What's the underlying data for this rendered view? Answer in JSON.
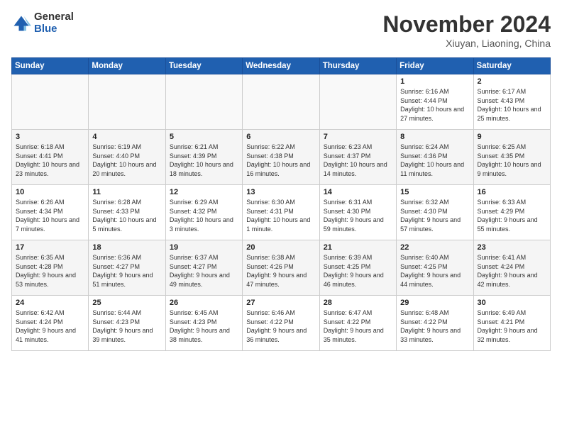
{
  "header": {
    "logo_general": "General",
    "logo_blue": "Blue",
    "month_title": "November 2024",
    "location": "Xiuyan, Liaoning, China"
  },
  "weekdays": [
    "Sunday",
    "Monday",
    "Tuesday",
    "Wednesday",
    "Thursday",
    "Friday",
    "Saturday"
  ],
  "weeks": [
    [
      {
        "day": "",
        "empty": true
      },
      {
        "day": "",
        "empty": true
      },
      {
        "day": "",
        "empty": true
      },
      {
        "day": "",
        "empty": true
      },
      {
        "day": "",
        "empty": true
      },
      {
        "day": "1",
        "sunrise": "Sunrise: 6:16 AM",
        "sunset": "Sunset: 4:44 PM",
        "daylight": "Daylight: 10 hours and 27 minutes."
      },
      {
        "day": "2",
        "sunrise": "Sunrise: 6:17 AM",
        "sunset": "Sunset: 4:43 PM",
        "daylight": "Daylight: 10 hours and 25 minutes."
      }
    ],
    [
      {
        "day": "3",
        "sunrise": "Sunrise: 6:18 AM",
        "sunset": "Sunset: 4:41 PM",
        "daylight": "Daylight: 10 hours and 23 minutes."
      },
      {
        "day": "4",
        "sunrise": "Sunrise: 6:19 AM",
        "sunset": "Sunset: 4:40 PM",
        "daylight": "Daylight: 10 hours and 20 minutes."
      },
      {
        "day": "5",
        "sunrise": "Sunrise: 6:21 AM",
        "sunset": "Sunset: 4:39 PM",
        "daylight": "Daylight: 10 hours and 18 minutes."
      },
      {
        "day": "6",
        "sunrise": "Sunrise: 6:22 AM",
        "sunset": "Sunset: 4:38 PM",
        "daylight": "Daylight: 10 hours and 16 minutes."
      },
      {
        "day": "7",
        "sunrise": "Sunrise: 6:23 AM",
        "sunset": "Sunset: 4:37 PM",
        "daylight": "Daylight: 10 hours and 14 minutes."
      },
      {
        "day": "8",
        "sunrise": "Sunrise: 6:24 AM",
        "sunset": "Sunset: 4:36 PM",
        "daylight": "Daylight: 10 hours and 11 minutes."
      },
      {
        "day": "9",
        "sunrise": "Sunrise: 6:25 AM",
        "sunset": "Sunset: 4:35 PM",
        "daylight": "Daylight: 10 hours and 9 minutes."
      }
    ],
    [
      {
        "day": "10",
        "sunrise": "Sunrise: 6:26 AM",
        "sunset": "Sunset: 4:34 PM",
        "daylight": "Daylight: 10 hours and 7 minutes."
      },
      {
        "day": "11",
        "sunrise": "Sunrise: 6:28 AM",
        "sunset": "Sunset: 4:33 PM",
        "daylight": "Daylight: 10 hours and 5 minutes."
      },
      {
        "day": "12",
        "sunrise": "Sunrise: 6:29 AM",
        "sunset": "Sunset: 4:32 PM",
        "daylight": "Daylight: 10 hours and 3 minutes."
      },
      {
        "day": "13",
        "sunrise": "Sunrise: 6:30 AM",
        "sunset": "Sunset: 4:31 PM",
        "daylight": "Daylight: 10 hours and 1 minute."
      },
      {
        "day": "14",
        "sunrise": "Sunrise: 6:31 AM",
        "sunset": "Sunset: 4:30 PM",
        "daylight": "Daylight: 9 hours and 59 minutes."
      },
      {
        "day": "15",
        "sunrise": "Sunrise: 6:32 AM",
        "sunset": "Sunset: 4:30 PM",
        "daylight": "Daylight: 9 hours and 57 minutes."
      },
      {
        "day": "16",
        "sunrise": "Sunrise: 6:33 AM",
        "sunset": "Sunset: 4:29 PM",
        "daylight": "Daylight: 9 hours and 55 minutes."
      }
    ],
    [
      {
        "day": "17",
        "sunrise": "Sunrise: 6:35 AM",
        "sunset": "Sunset: 4:28 PM",
        "daylight": "Daylight: 9 hours and 53 minutes."
      },
      {
        "day": "18",
        "sunrise": "Sunrise: 6:36 AM",
        "sunset": "Sunset: 4:27 PM",
        "daylight": "Daylight: 9 hours and 51 minutes."
      },
      {
        "day": "19",
        "sunrise": "Sunrise: 6:37 AM",
        "sunset": "Sunset: 4:27 PM",
        "daylight": "Daylight: 9 hours and 49 minutes."
      },
      {
        "day": "20",
        "sunrise": "Sunrise: 6:38 AM",
        "sunset": "Sunset: 4:26 PM",
        "daylight": "Daylight: 9 hours and 47 minutes."
      },
      {
        "day": "21",
        "sunrise": "Sunrise: 6:39 AM",
        "sunset": "Sunset: 4:25 PM",
        "daylight": "Daylight: 9 hours and 46 minutes."
      },
      {
        "day": "22",
        "sunrise": "Sunrise: 6:40 AM",
        "sunset": "Sunset: 4:25 PM",
        "daylight": "Daylight: 9 hours and 44 minutes."
      },
      {
        "day": "23",
        "sunrise": "Sunrise: 6:41 AM",
        "sunset": "Sunset: 4:24 PM",
        "daylight": "Daylight: 9 hours and 42 minutes."
      }
    ],
    [
      {
        "day": "24",
        "sunrise": "Sunrise: 6:42 AM",
        "sunset": "Sunset: 4:24 PM",
        "daylight": "Daylight: 9 hours and 41 minutes."
      },
      {
        "day": "25",
        "sunrise": "Sunrise: 6:44 AM",
        "sunset": "Sunset: 4:23 PM",
        "daylight": "Daylight: 9 hours and 39 minutes."
      },
      {
        "day": "26",
        "sunrise": "Sunrise: 6:45 AM",
        "sunset": "Sunset: 4:23 PM",
        "daylight": "Daylight: 9 hours and 38 minutes."
      },
      {
        "day": "27",
        "sunrise": "Sunrise: 6:46 AM",
        "sunset": "Sunset: 4:22 PM",
        "daylight": "Daylight: 9 hours and 36 minutes."
      },
      {
        "day": "28",
        "sunrise": "Sunrise: 6:47 AM",
        "sunset": "Sunset: 4:22 PM",
        "daylight": "Daylight: 9 hours and 35 minutes."
      },
      {
        "day": "29",
        "sunrise": "Sunrise: 6:48 AM",
        "sunset": "Sunset: 4:22 PM",
        "daylight": "Daylight: 9 hours and 33 minutes."
      },
      {
        "day": "30",
        "sunrise": "Sunrise: 6:49 AM",
        "sunset": "Sunset: 4:21 PM",
        "daylight": "Daylight: 9 hours and 32 minutes."
      }
    ]
  ]
}
